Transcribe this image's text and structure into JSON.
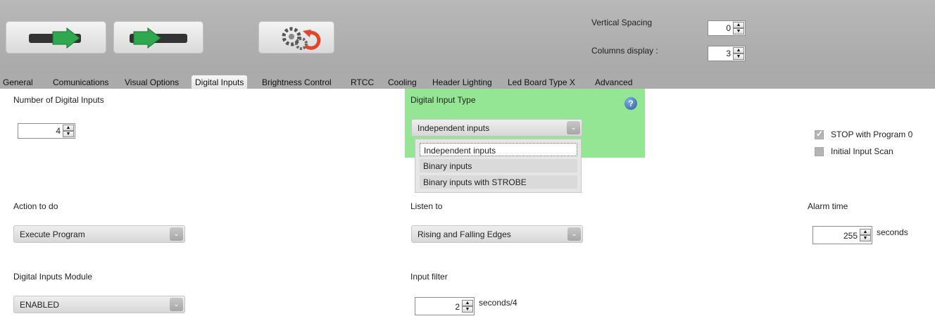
{
  "toolbar": {
    "vertical_spacing_label": "Vertical Spacing",
    "vertical_spacing_value": "0",
    "columns_display_label": "Columns display :",
    "columns_display_value": "3"
  },
  "tabs": [
    {
      "label": "General"
    },
    {
      "label": "Comunications"
    },
    {
      "label": "Visual Options"
    },
    {
      "label": "Digital Inputs",
      "active": true
    },
    {
      "label": "Brightness Control"
    },
    {
      "label": "RTCC"
    },
    {
      "label": "Cooling"
    },
    {
      "label": "Header Lighting"
    },
    {
      "label": "Led Board Type X"
    },
    {
      "label": "Advanced"
    }
  ],
  "digital_inputs": {
    "number_label": "Number of Digital Inputs",
    "number_value": "4",
    "type_label": "Digital Input Type",
    "type_selected": "Independent inputs",
    "type_options": [
      "Independent inputs",
      "Binary inputs",
      "Binary inputs with STROBE"
    ],
    "help_icon": "?",
    "stop_with_program0_label": "STOP with Program 0",
    "stop_with_program0_checked": true,
    "initial_input_scan_label": "Initial Input Scan",
    "initial_input_scan_checked": false,
    "action_label": "Action to do",
    "action_value": "Execute Program",
    "listen_label": "Listen to",
    "listen_value": "Rising and Falling Edges",
    "alarm_label": "Alarm time",
    "alarm_value": "255",
    "alarm_unit": "seconds",
    "module_label": "Digital Inputs Module",
    "module_value": "ENABLED",
    "filter_label": "Input filter",
    "filter_value": "2",
    "filter_unit": "seconds/4"
  },
  "colors": {
    "highlight_green": "#94e694",
    "toolbar_gray": "#ababab",
    "arrow_green": "#2fa84f",
    "reset_orange": "#e0452a"
  },
  "icons": [
    "arrow-send-icon",
    "arrow-receive-icon",
    "gears-reset-icon",
    "help-icon",
    "chevron-down-icon"
  ]
}
